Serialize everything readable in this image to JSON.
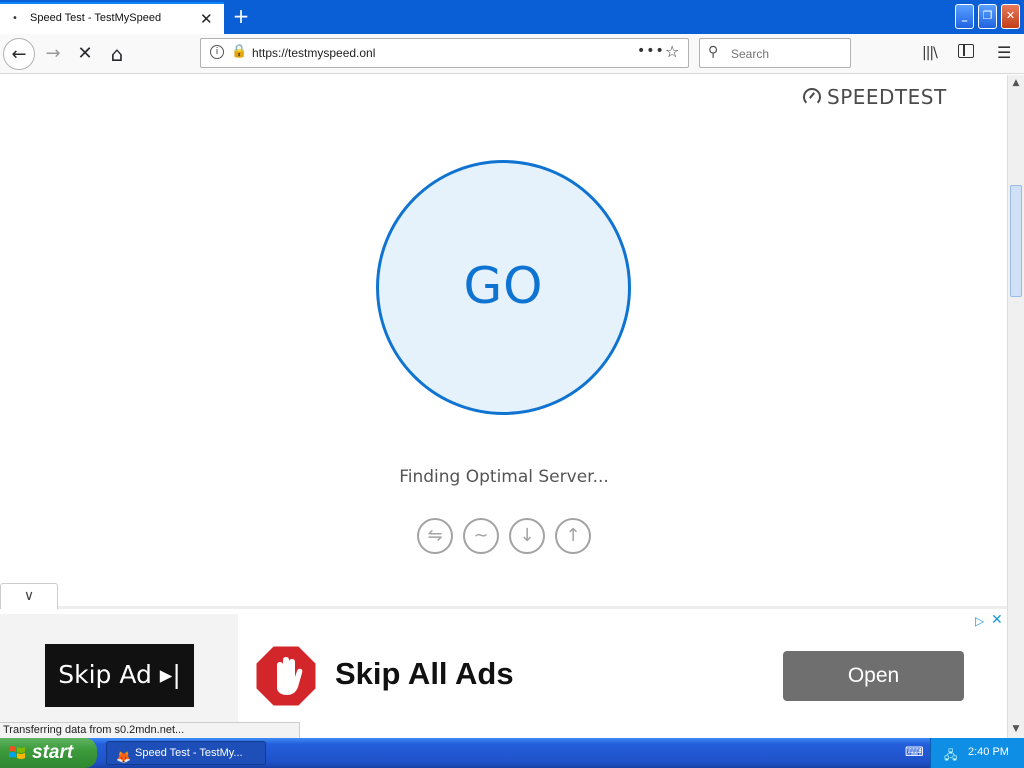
{
  "browser": {
    "tab": {
      "title": "Speed Test - TestMySpeed",
      "favicon": "•",
      "close": "✕"
    },
    "new_tab": "+",
    "nav": {
      "back": "←",
      "forward": "→",
      "stop": "✕",
      "home": "⌂"
    },
    "url": "https://testmyspeed.onl",
    "url_info": "i",
    "page_actions": "•••",
    "bookmark": "☆",
    "search": {
      "icon": "⚲",
      "placeholder": "Search"
    },
    "window_buttons": {
      "minimize": "_",
      "restore": "❐",
      "close": "✕"
    }
  },
  "page": {
    "brand": "SPEEDTEST",
    "go_label": "GO",
    "status": "Finding Optimal Server...",
    "metric_icons": [
      "⇋",
      "∼",
      "↓",
      "↑"
    ],
    "collapse_chevron": "∨"
  },
  "ad": {
    "skip_ad_label": "Skip Ad ▸|",
    "headline": "Skip All Ads",
    "open_label": "Open",
    "adchoice_icon": "▷",
    "close_icon": "✕"
  },
  "status_bar": {
    "text": "Transferring data from s0.2mdn.net..."
  },
  "taskbar": {
    "start_label": "start",
    "task_item": "Speed Test - TestMy...",
    "clock": "2:40 PM"
  },
  "colors": {
    "accent": "#0f74d1",
    "go_fill": "#e5f1fb",
    "taskbar": "#245edc",
    "start": "#3c9b3c"
  }
}
